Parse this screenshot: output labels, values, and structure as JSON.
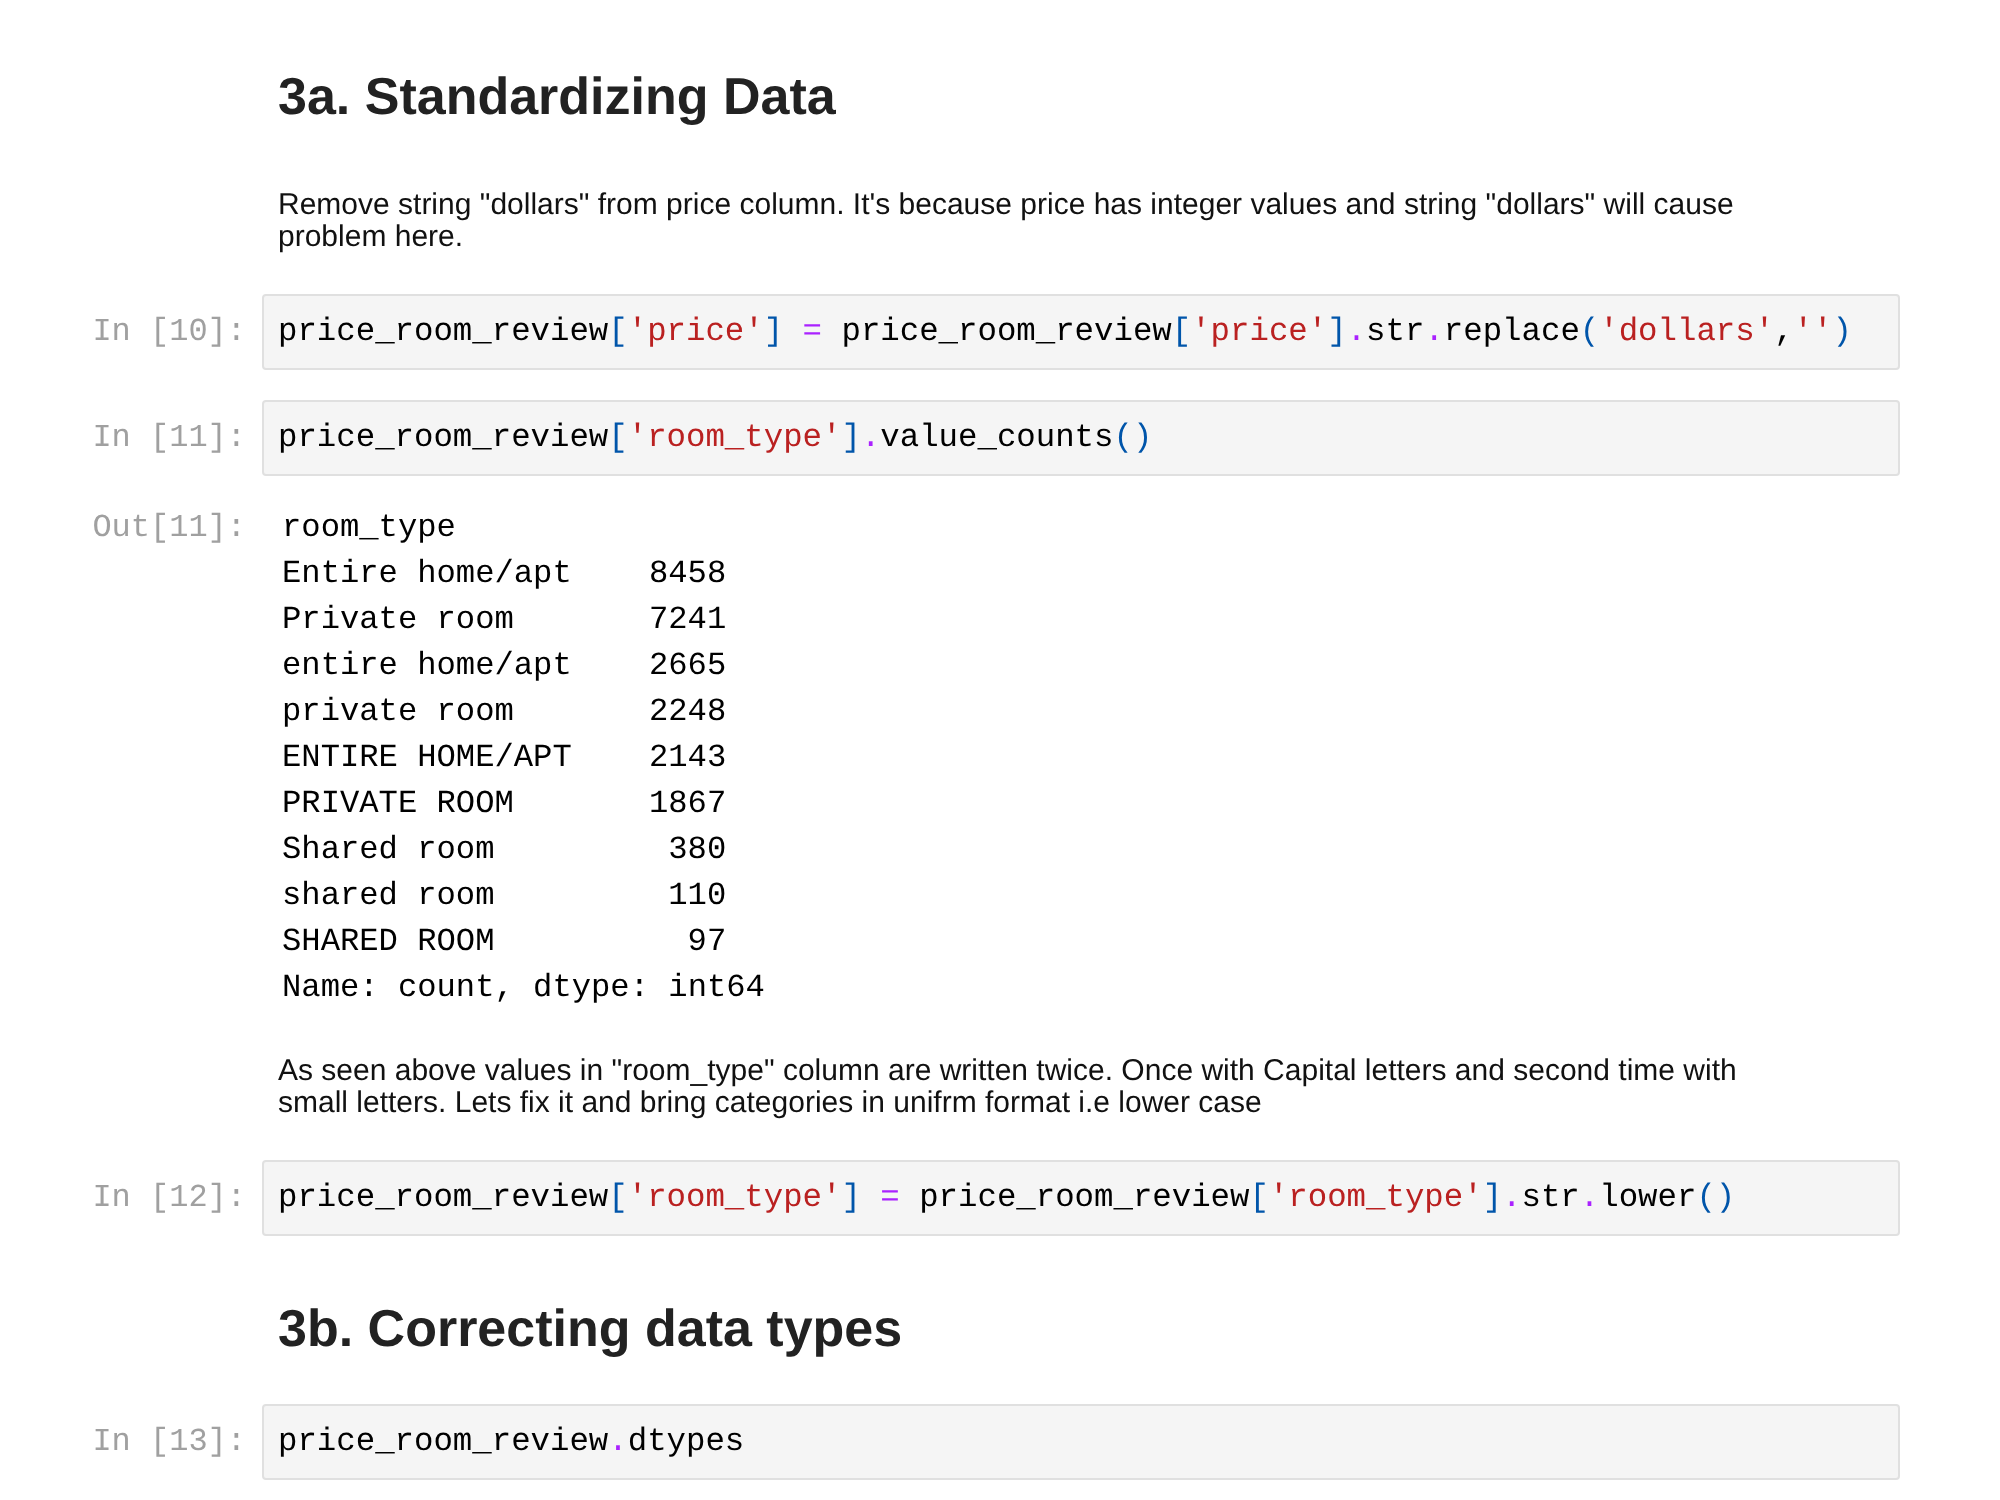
{
  "notebook": {
    "cells": [
      {
        "kind": "heading",
        "text": "3a. Standardizing Data"
      },
      {
        "kind": "markdown",
        "text": "Remove string \"dollars\" from price column. It's because price has integer values and string \"dollars\" will cause problem here."
      },
      {
        "kind": "code",
        "prompt": "In [10]:",
        "tokens": [
          {
            "kind": "plain",
            "text": "price_room_review"
          },
          {
            "kind": "bracket",
            "text": "["
          },
          {
            "kind": "string",
            "text": "'price'"
          },
          {
            "kind": "bracket",
            "text": "]"
          },
          {
            "kind": "operator",
            "text": " = "
          },
          {
            "kind": "plain",
            "text": "price_room_review"
          },
          {
            "kind": "bracket",
            "text": "["
          },
          {
            "kind": "string",
            "text": "'price'"
          },
          {
            "kind": "bracket",
            "text": "]"
          },
          {
            "kind": "operator",
            "text": "."
          },
          {
            "kind": "plain",
            "text": "str"
          },
          {
            "kind": "operator",
            "text": "."
          },
          {
            "kind": "plain",
            "text": "replace"
          },
          {
            "kind": "bracket",
            "text": "("
          },
          {
            "kind": "string",
            "text": "'dollars'"
          },
          {
            "kind": "plain",
            "text": ","
          },
          {
            "kind": "string",
            "text": "''"
          },
          {
            "kind": "bracket",
            "text": ")"
          }
        ]
      },
      {
        "kind": "code",
        "prompt": "In [11]:",
        "tokens": [
          {
            "kind": "plain",
            "text": "price_room_review"
          },
          {
            "kind": "bracket",
            "text": "["
          },
          {
            "kind": "string",
            "text": "'room_type'"
          },
          {
            "kind": "bracket",
            "text": "]"
          },
          {
            "kind": "operator",
            "text": "."
          },
          {
            "kind": "plain",
            "text": "value_counts"
          },
          {
            "kind": "bracket",
            "text": "()"
          }
        ]
      },
      {
        "kind": "output",
        "prompt": "Out[11]:",
        "index_name": "room_type",
        "rows": [
          {
            "label": "Entire home/apt",
            "count": "8458"
          },
          {
            "label": "Private room",
            "count": "7241"
          },
          {
            "label": "entire home/apt",
            "count": "2665"
          },
          {
            "label": "private room",
            "count": "2248"
          },
          {
            "label": "ENTIRE HOME/APT",
            "count": "2143"
          },
          {
            "label": "PRIVATE ROOM",
            "count": "1867"
          },
          {
            "label": "Shared room",
            "count": "380"
          },
          {
            "label": "shared room",
            "count": "110"
          },
          {
            "label": "SHARED ROOM",
            "count": "97"
          }
        ],
        "footer": "Name: count, dtype: int64"
      },
      {
        "kind": "markdown",
        "text": "As seen above values in \"room_type\" column are written twice. Once with Capital letters and second time with small letters. Lets fix it and bring categories in unifrm format i.e lower case"
      },
      {
        "kind": "code",
        "prompt": "In [12]:",
        "tokens": [
          {
            "kind": "plain",
            "text": "price_room_review"
          },
          {
            "kind": "bracket",
            "text": "["
          },
          {
            "kind": "string",
            "text": "'room_type'"
          },
          {
            "kind": "bracket",
            "text": "]"
          },
          {
            "kind": "operator",
            "text": " = "
          },
          {
            "kind": "plain",
            "text": "price_room_review"
          },
          {
            "kind": "bracket",
            "text": "["
          },
          {
            "kind": "string",
            "text": "'room_type'"
          },
          {
            "kind": "bracket",
            "text": "]"
          },
          {
            "kind": "operator",
            "text": "."
          },
          {
            "kind": "plain",
            "text": "str"
          },
          {
            "kind": "operator",
            "text": "."
          },
          {
            "kind": "plain",
            "text": "lower"
          },
          {
            "kind": "bracket",
            "text": "()"
          }
        ]
      },
      {
        "kind": "heading",
        "text": "3b. Correcting data types"
      },
      {
        "kind": "code",
        "prompt": "In [13]:",
        "tokens": [
          {
            "kind": "plain",
            "text": "price_room_review"
          },
          {
            "kind": "operator",
            "text": "."
          },
          {
            "kind": "plain",
            "text": "dtypes"
          }
        ]
      }
    ]
  }
}
